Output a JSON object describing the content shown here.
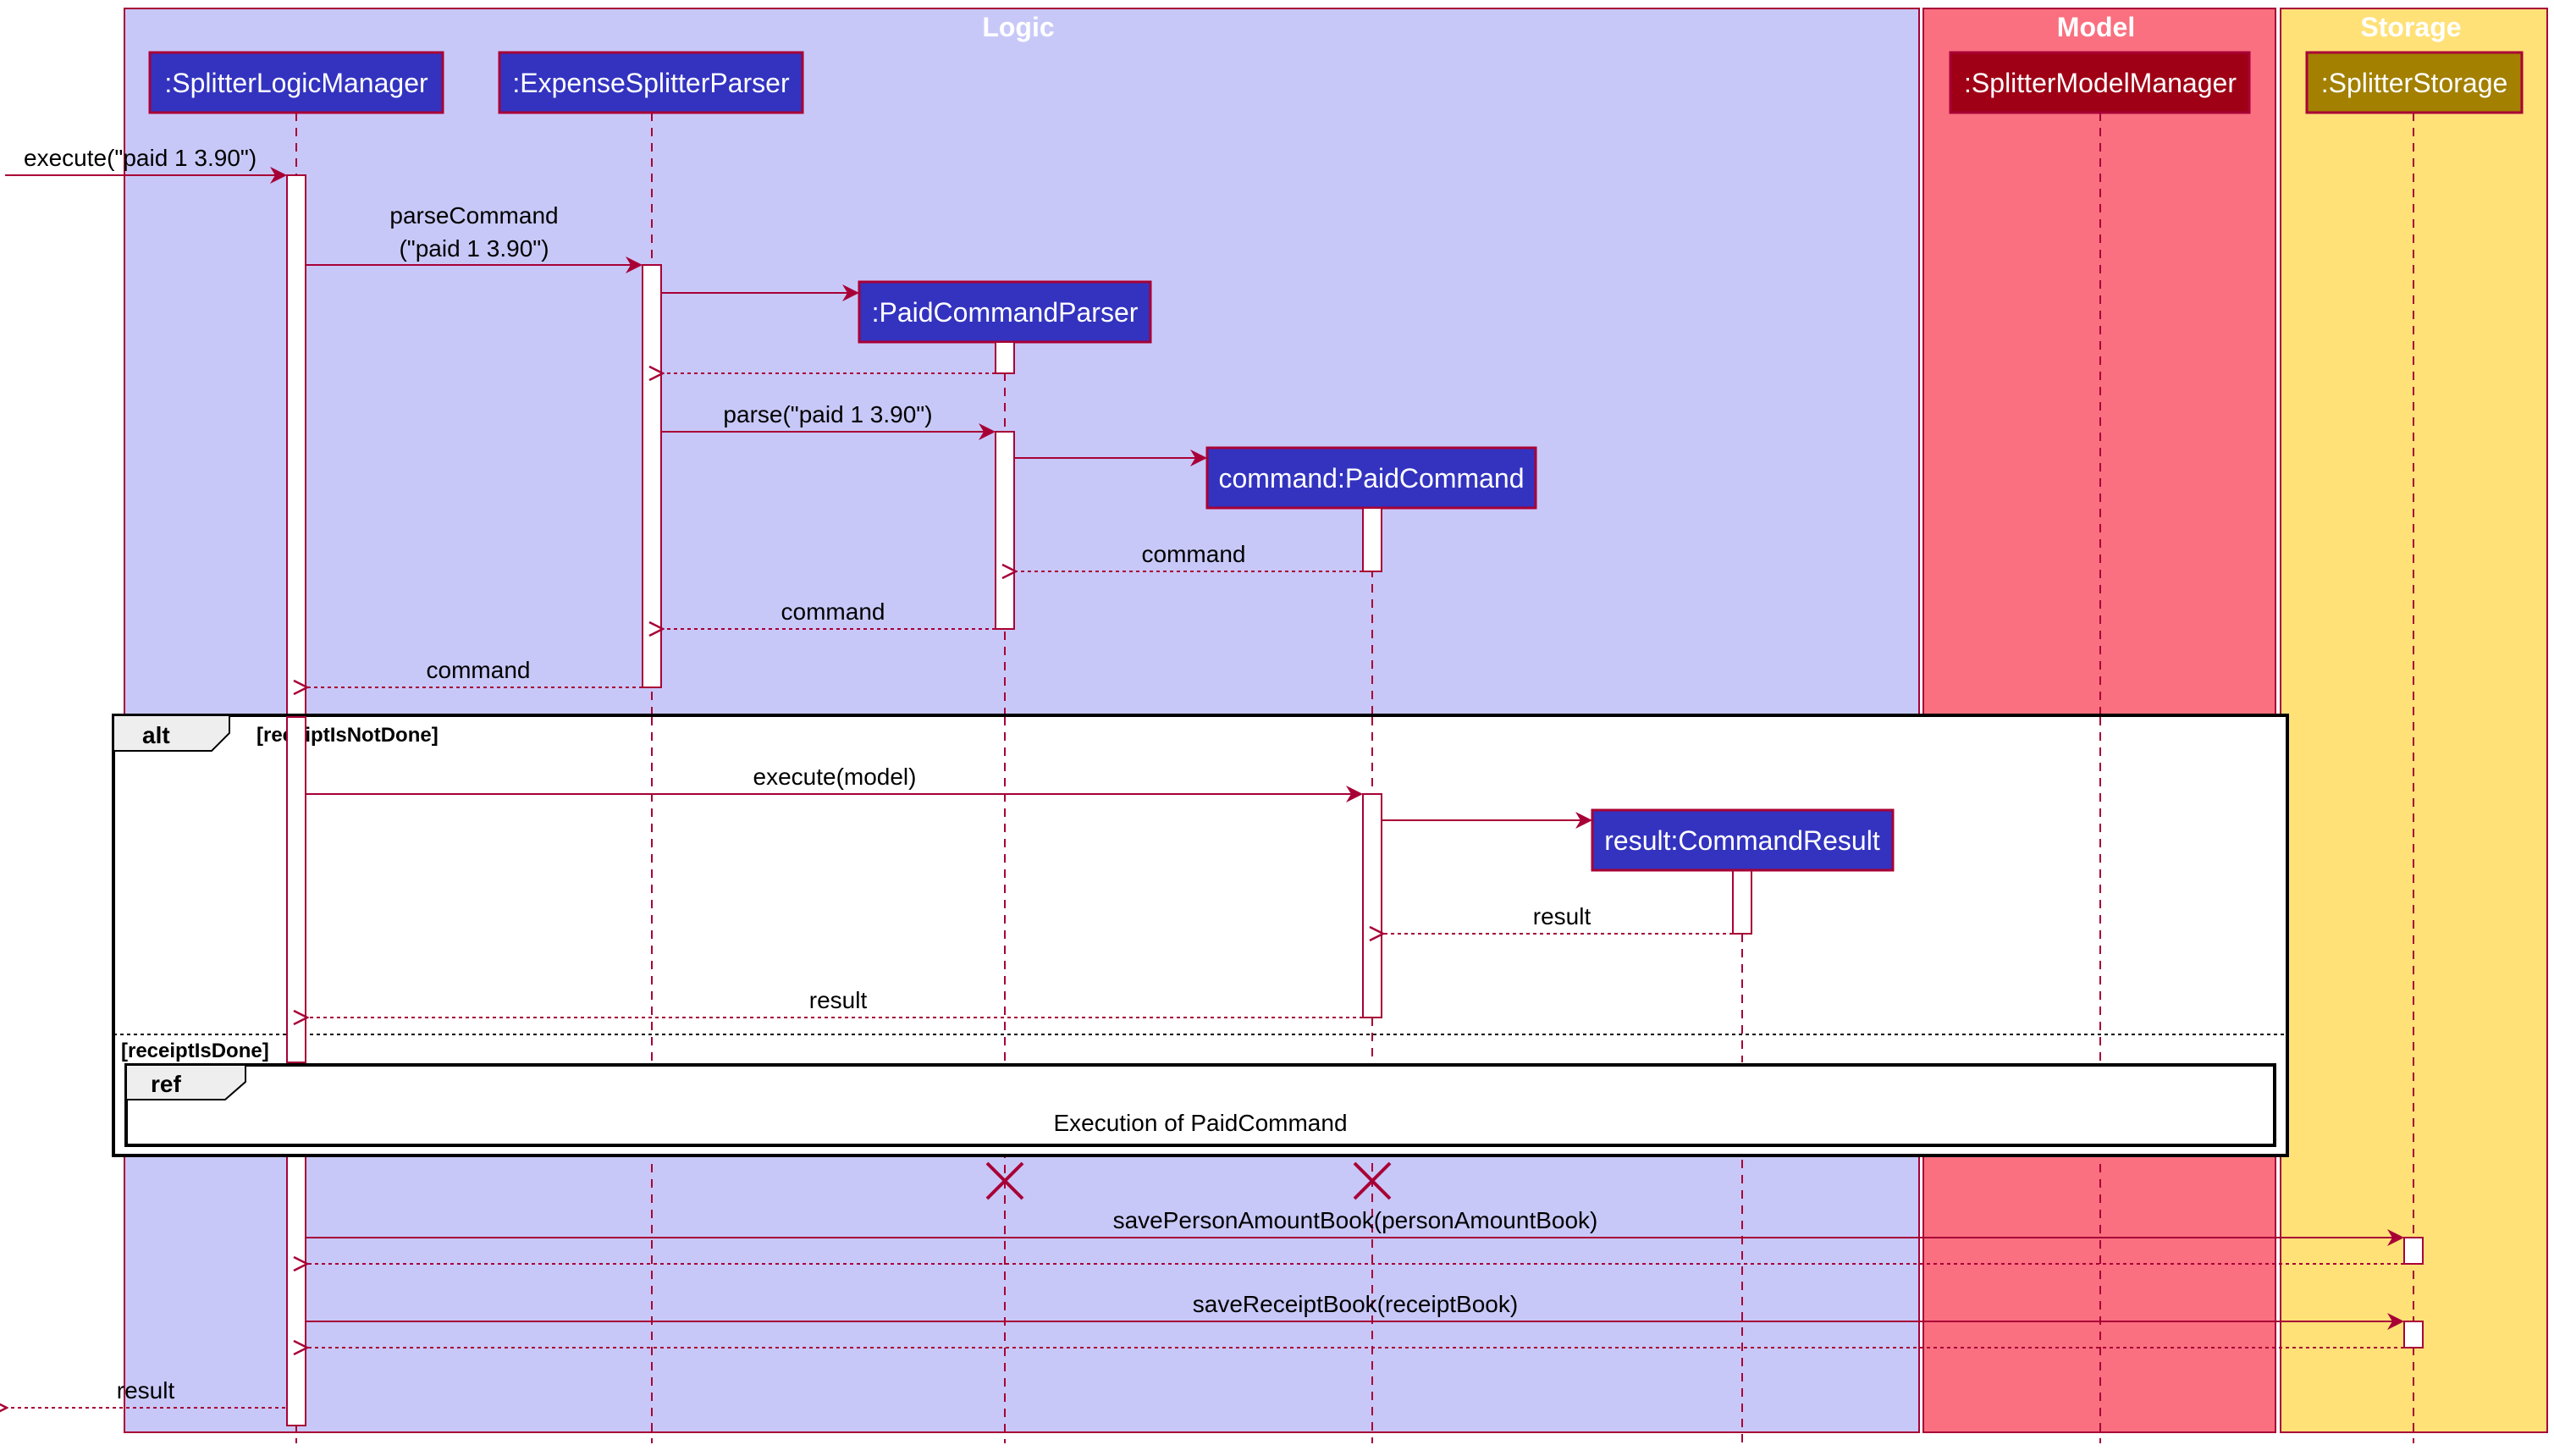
{
  "diagram": {
    "type": "sequence",
    "colors": {
      "logic_box": "#C8C8F8",
      "model_box": "#FA7080",
      "storage_box": "#FFE178",
      "participant_logic": "#3333C0",
      "participant_model": "#9F0015",
      "participant_storage": "#A38000",
      "line": "#A80036",
      "fragment_border": "#000000",
      "fragment_tab": "#EEEEEE"
    },
    "boxes": [
      {
        "id": "logic",
        "title": "Logic"
      },
      {
        "id": "model",
        "title": "Model"
      },
      {
        "id": "storage",
        "title": "Storage"
      }
    ],
    "participants": [
      {
        "id": "slm",
        "label": ":SplitterLogicManager"
      },
      {
        "id": "esp",
        "label": ":ExpenseSplitterParser"
      },
      {
        "id": "pcp",
        "label": ":PaidCommandParser"
      },
      {
        "id": "pc",
        "label": "command:PaidCommand"
      },
      {
        "id": "cr",
        "label": "result:CommandResult"
      },
      {
        "id": "smm",
        "label": ":SplitterModelManager"
      },
      {
        "id": "ss",
        "label": ":SplitterStorage"
      }
    ],
    "messages": [
      {
        "from": "external",
        "to": "slm",
        "label": "execute(\"paid 1 3.90\")",
        "kind": "sync"
      },
      {
        "from": "slm",
        "to": "esp",
        "label_line1": "parseCommand",
        "label_line2": "(\"paid 1 3.90\")",
        "kind": "sync"
      },
      {
        "from": "esp",
        "to": "pcp",
        "label": "",
        "kind": "create"
      },
      {
        "from": "pcp",
        "to": "esp",
        "label": "",
        "kind": "return"
      },
      {
        "from": "esp",
        "to": "pcp",
        "label": "parse(\"paid 1 3.90\")",
        "kind": "sync"
      },
      {
        "from": "pcp",
        "to": "pc",
        "label": "",
        "kind": "create"
      },
      {
        "from": "pc",
        "to": "pcp",
        "label": "command",
        "kind": "return"
      },
      {
        "from": "pcp",
        "to": "esp",
        "label": "command",
        "kind": "return"
      },
      {
        "from": "esp",
        "to": "slm",
        "label": "command",
        "kind": "return"
      },
      {
        "from": "slm",
        "to": "pc",
        "label": "execute(model)",
        "kind": "sync"
      },
      {
        "from": "pc",
        "to": "cr",
        "label": "",
        "kind": "create"
      },
      {
        "from": "cr",
        "to": "pc",
        "label": "result",
        "kind": "return"
      },
      {
        "from": "pc",
        "to": "slm",
        "label": "result",
        "kind": "return"
      },
      {
        "from": "slm",
        "to": "ss",
        "label": "savePersonAmountBook(personAmountBook)",
        "kind": "sync"
      },
      {
        "from": "ss",
        "to": "slm",
        "label": "",
        "kind": "return"
      },
      {
        "from": "slm",
        "to": "ss",
        "label": "saveReceiptBook(receiptBook)",
        "kind": "sync"
      },
      {
        "from": "ss",
        "to": "slm",
        "label": "",
        "kind": "return"
      },
      {
        "from": "slm",
        "to": "external",
        "label": "result",
        "kind": "return"
      }
    ],
    "fragments": {
      "alt": {
        "keyword": "alt",
        "guard1": "[receiptIsNotDone]",
        "guard2": "[receiptIsDone]"
      },
      "ref": {
        "keyword": "ref",
        "text": "Execution of PaidCommand"
      }
    },
    "destroyed": [
      "pcp",
      "pc"
    ]
  }
}
